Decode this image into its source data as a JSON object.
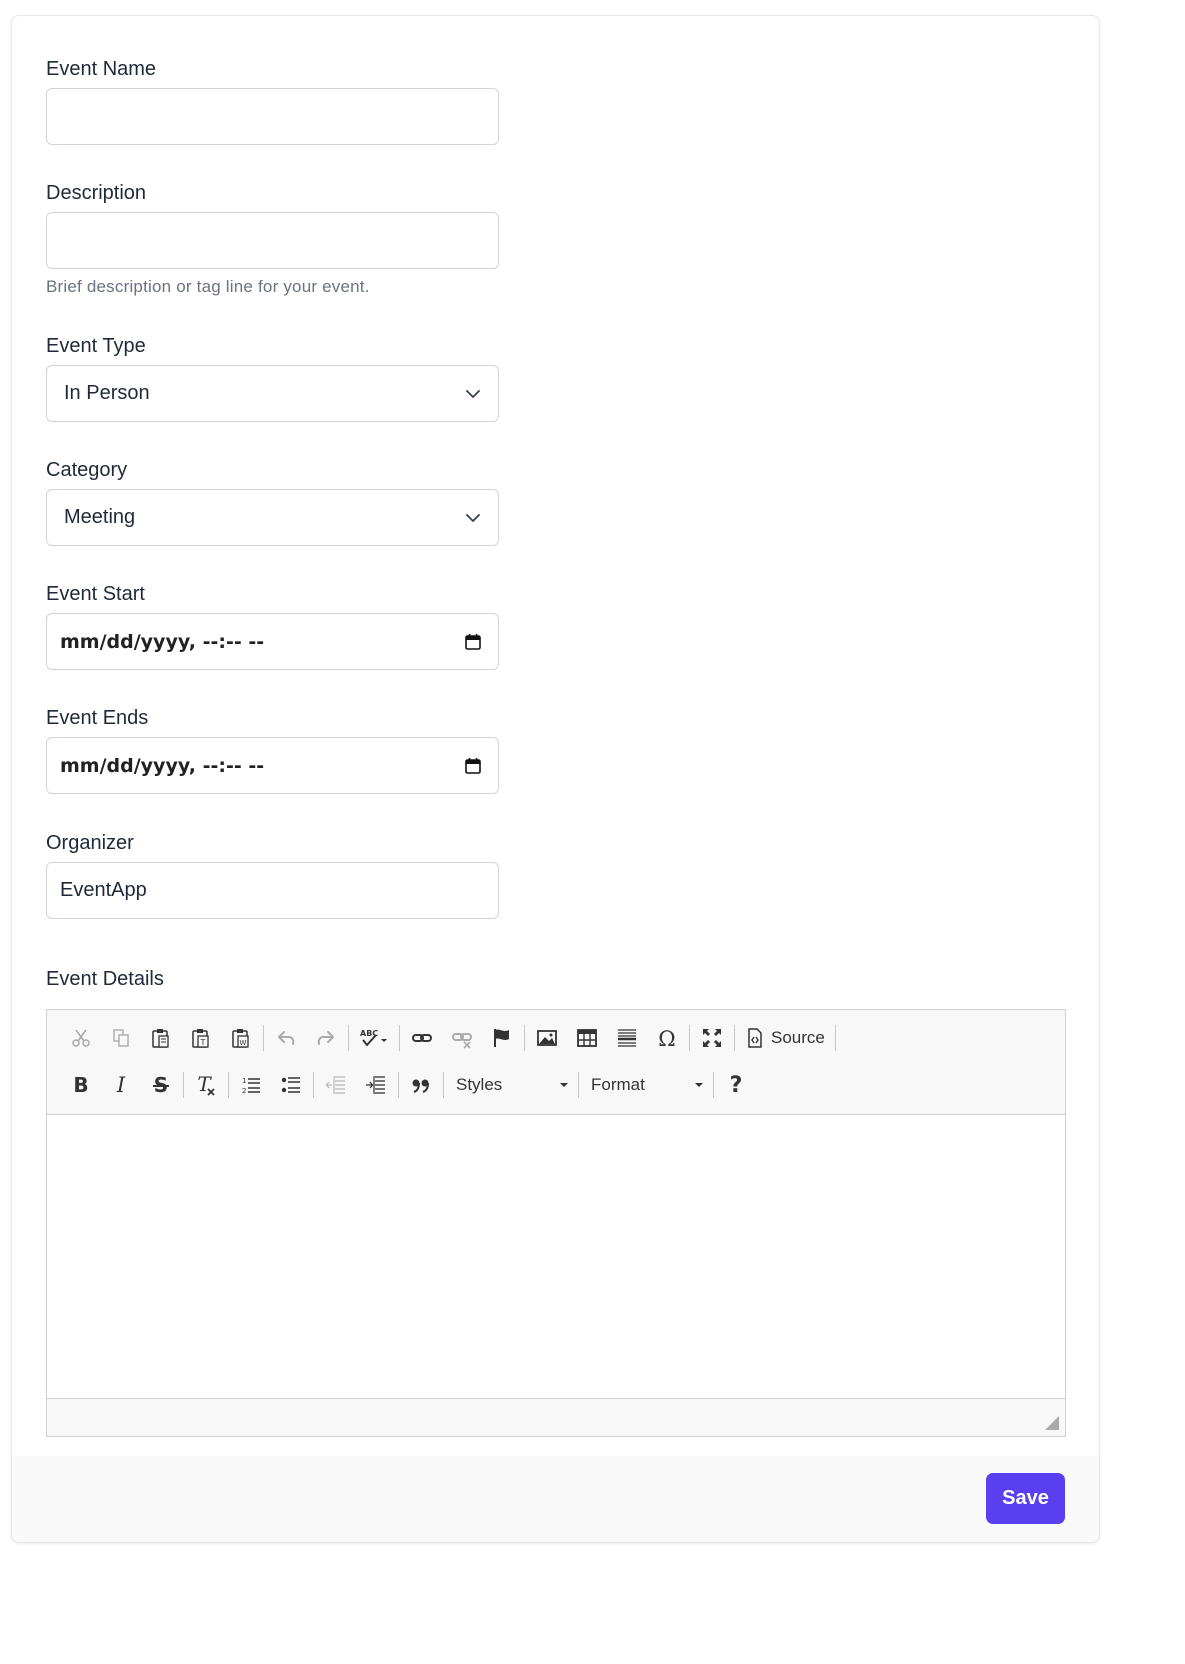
{
  "form": {
    "event_name": {
      "label": "Event Name",
      "value": ""
    },
    "description": {
      "label": "Description",
      "value": "",
      "help": "Brief description or tag line for your event."
    },
    "event_type": {
      "label": "Event Type",
      "value": "In Person"
    },
    "category": {
      "label": "Category",
      "value": "Meeting"
    },
    "event_start": {
      "label": "Event Start",
      "value": "mm/dd/yyyy, --:-- --"
    },
    "event_ends": {
      "label": "Event Ends",
      "value": "mm/dd/yyyy, --:-- --"
    },
    "organizer": {
      "label": "Organizer",
      "value": "EventApp"
    },
    "event_details": {
      "label": "Event Details"
    }
  },
  "editor": {
    "source_label": "Source",
    "styles_label": "Styles",
    "format_label": "Format",
    "help_glyph": "?",
    "icons_row1": [
      "cut-icon",
      "copy-icon",
      "paste-icon",
      "paste-text-icon",
      "paste-word-icon",
      "undo-icon",
      "redo-icon",
      "spellcheck-icon",
      "link-icon",
      "unlink-icon",
      "anchor-flag-icon",
      "image-icon",
      "table-icon",
      "horizontal-line-icon",
      "special-char-icon",
      "maximize-icon",
      "source-icon"
    ],
    "icons_row2": [
      "bold-icon",
      "italic-icon",
      "strikethrough-icon",
      "remove-format-icon",
      "numbered-list-icon",
      "bulleted-list-icon",
      "outdent-icon",
      "indent-icon",
      "blockquote-icon",
      "help-icon"
    ]
  },
  "footer": {
    "save_label": "Save"
  },
  "colors": {
    "accent": "#5a3ff0",
    "border": "#d1d5db",
    "help_text": "#6b7280"
  }
}
